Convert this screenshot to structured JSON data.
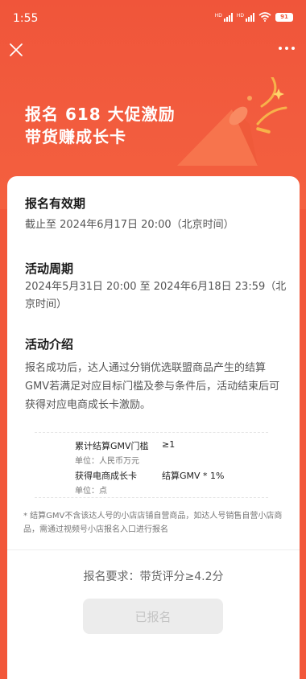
{
  "status_bar": {
    "time": "1:55",
    "battery": "91"
  },
  "hero": {
    "title_line1": "报名 618 大促激励",
    "title_line2": "带货赚成长卡"
  },
  "sections": {
    "validity": {
      "title": "报名有效期",
      "text": "截止至 2024年6月17日 20:00（北京时间）"
    },
    "period": {
      "title": "活动周期",
      "text": "2024年5月31日 20:00 至 2024年6月18日 23:59（北京时间）"
    },
    "intro": {
      "title": "活动介绍",
      "text": "报名成功后，达人通过分销优选联盟商品产生的结算GMV若满足对应目标门槛及参与条件后，活动结束后可获得对应电商成长卡激励。"
    }
  },
  "table": {
    "rows": [
      {
        "label": "累计结算GMV门槛",
        "unit": "单位：人民币万元",
        "value": "≥1"
      },
      {
        "label": "获得电商成长卡",
        "unit": "单位：点",
        "value": "结算GMV * 1%"
      }
    ]
  },
  "footnote": "* 结算GMV不含该达人号的小店店铺自营商品，如达人号销售自营小店商品，需通过视频号小店报名入口进行报名",
  "requirement": "报名要求：带货评分≥4.2分",
  "signup_button": "已报名",
  "colors": {
    "brand": "#f2573a",
    "button_disabled_bg": "#ececec",
    "button_disabled_text": "#c4c4c4"
  }
}
